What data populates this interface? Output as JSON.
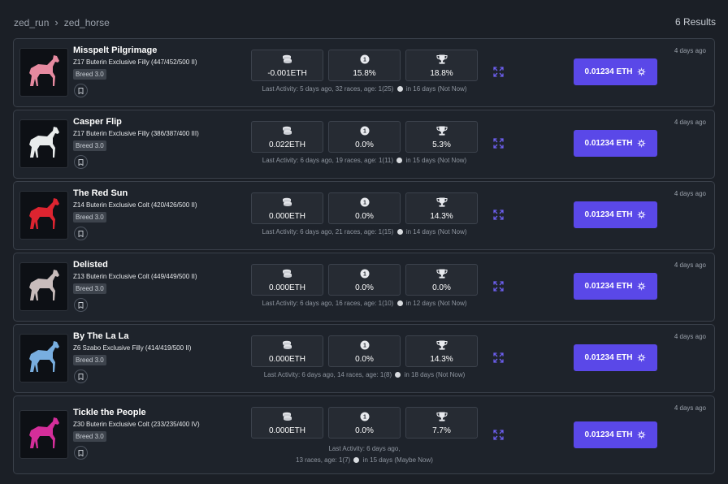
{
  "breadcrumb": {
    "root": "zed_run",
    "current": "zed_horse"
  },
  "results_label": "6 Results",
  "horses": [
    {
      "name": "Misspelt Pilgrimage",
      "desc": "Z17 Buterin Exclusive Filly (447/452/500 II)",
      "breed": "Breed 3.0",
      "stats": [
        "-0.001ETH",
        "15.8%",
        "18.8%"
      ],
      "activity": [
        "Last Activity: 5 days ago, 32 races, age: 1(25)",
        "in 16 days (Not Now)"
      ],
      "price": "0.01234 ETH",
      "ago": "4 days ago",
      "color": "#e68aa0"
    },
    {
      "name": "Casper Flip",
      "desc": "Z17 Buterin Exclusive Filly (386/387/400 III)",
      "breed": "Breed 3.0",
      "stats": [
        "0.022ETH",
        "0.0%",
        "5.3%"
      ],
      "activity": [
        "Last Activity: 6 days ago, 19 races, age: 1(11)",
        "in 15 days (Not Now)"
      ],
      "price": "0.01234 ETH",
      "ago": "4 days ago",
      "color": "#e9ecec"
    },
    {
      "name": "The Red Sun",
      "desc": "Z14 Buterin Exclusive Colt (420/426/500 II)",
      "breed": "Breed 3.0",
      "stats": [
        "0.000ETH",
        "0.0%",
        "14.3%"
      ],
      "activity": [
        "Last Activity: 6 days ago, 21 races, age: 1(15)",
        "in 14 days (Not Now)"
      ],
      "price": "0.01234 ETH",
      "ago": "4 days ago",
      "color": "#dd2430"
    },
    {
      "name": "Delisted",
      "desc": "Z13 Buterin Exclusive Colt (449/449/500 II)",
      "breed": "Breed 3.0",
      "stats": [
        "0.000ETH",
        "0.0%",
        "0.0%"
      ],
      "activity": [
        "Last Activity: 6 days ago, 16 races, age: 1(10)",
        "in 12 days (Not Now)"
      ],
      "price": "0.01234 ETH",
      "ago": "4 days ago",
      "color": "#c8bcbc"
    },
    {
      "name": "By The La La",
      "desc": "Z6 Szabo Exclusive Filly (414/419/500 II)",
      "breed": "Breed 3.0",
      "stats": [
        "0.000ETH",
        "0.0%",
        "14.3%"
      ],
      "activity": [
        "Last Activity: 6 days ago, 14 races, age: 1(8)",
        "in 18 days (Not Now)"
      ],
      "price": "0.01234 ETH",
      "ago": "4 days ago",
      "color": "#78aee0"
    },
    {
      "name": "Tickle the People",
      "desc": "Z30 Buterin Exclusive Colt (233/235/400 IV)",
      "breed": "Breed 3.0",
      "stats": [
        "0.000ETH",
        "0.0%",
        "7.7%"
      ],
      "activity": [
        "Last Activity: 6 days ago,",
        "13 races, age: 1(7)",
        "in 15 days (Maybe Now)"
      ],
      "price": "0.01234 ETH",
      "ago": "4 days ago",
      "color": "#d42e9a"
    }
  ]
}
